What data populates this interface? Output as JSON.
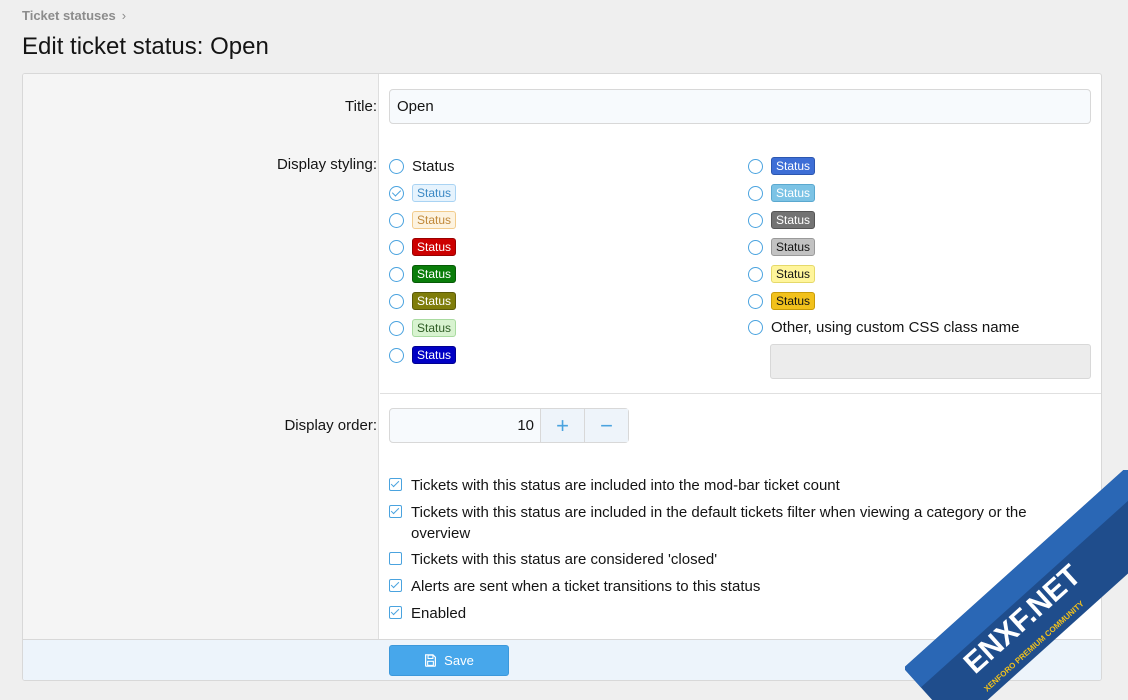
{
  "breadcrumb": {
    "item": "Ticket statuses",
    "sep": "›"
  },
  "page_title": "Edit ticket status: Open",
  "labels": {
    "title": "Title:",
    "display_styling": "Display styling:",
    "display_order": "Display order:"
  },
  "title_value": "Open",
  "styling": {
    "plain_label": "Status",
    "badge_label": "Status",
    "other_label": "Other, using custom CSS class name",
    "other_value": "",
    "selected_index": 1,
    "left_options": [
      {
        "kind": "plain"
      },
      {
        "kind": "badge",
        "bg": "#e6f3fd",
        "fg": "#3b88c4",
        "border": "#a9d3f3"
      },
      {
        "kind": "badge",
        "bg": "#fdf3e0",
        "fg": "#c0883a",
        "border": "#f2cc8d"
      },
      {
        "kind": "badge",
        "bg": "#cc0000",
        "fg": "#ffffff",
        "border": "#990000"
      },
      {
        "kind": "badge",
        "bg": "#0a7d0a",
        "fg": "#ffffff",
        "border": "#075a07"
      },
      {
        "kind": "badge",
        "bg": "#7f7d0a",
        "fg": "#ffffff",
        "border": "#5b5a07"
      },
      {
        "kind": "badge",
        "bg": "#d8f3d0",
        "fg": "#2f5d25",
        "border": "#a9dba0"
      },
      {
        "kind": "badge",
        "bg": "#0000c4",
        "fg": "#ffffff",
        "border": "#000090"
      }
    ],
    "right_options": [
      {
        "kind": "badge",
        "bg": "#3d6ed6",
        "fg": "#ffffff",
        "border": "#2c57b0"
      },
      {
        "kind": "badge",
        "bg": "#7cc3e5",
        "fg": "#ffffff",
        "border": "#5aa8cf"
      },
      {
        "kind": "badge",
        "bg": "#737373",
        "fg": "#ffffff",
        "border": "#555555"
      },
      {
        "kind": "badge",
        "bg": "#c2c2c2",
        "fg": "#141414",
        "border": "#9a9a9a"
      },
      {
        "kind": "badge",
        "bg": "#fff59b",
        "fg": "#141414",
        "border": "#e5d96a"
      },
      {
        "kind": "badge",
        "bg": "#f2c11b",
        "fg": "#141414",
        "border": "#c99c08"
      }
    ]
  },
  "display_order": {
    "value": "10",
    "plus": "+",
    "minus": "−"
  },
  "options": [
    {
      "label": "Tickets with this status are included into the mod-bar ticket count",
      "checked": true
    },
    {
      "label": "Tickets with this status are included in the default tickets filter when viewing a category or the overview",
      "checked": true
    },
    {
      "label": "Tickets with this status are considered 'closed'",
      "checked": false
    },
    {
      "label": "Alerts are sent when a ticket transitions to this status",
      "checked": true
    },
    {
      "label": "Enabled",
      "checked": true
    }
  ],
  "save_label": "Save",
  "watermark": {
    "main": "ENXF.NET",
    "sub": "XENFORO PREMIUM COMMUNITY"
  },
  "colors": {
    "accent": "#4aa3df",
    "save": "#47a7eb",
    "footer": "#edf4fb"
  }
}
